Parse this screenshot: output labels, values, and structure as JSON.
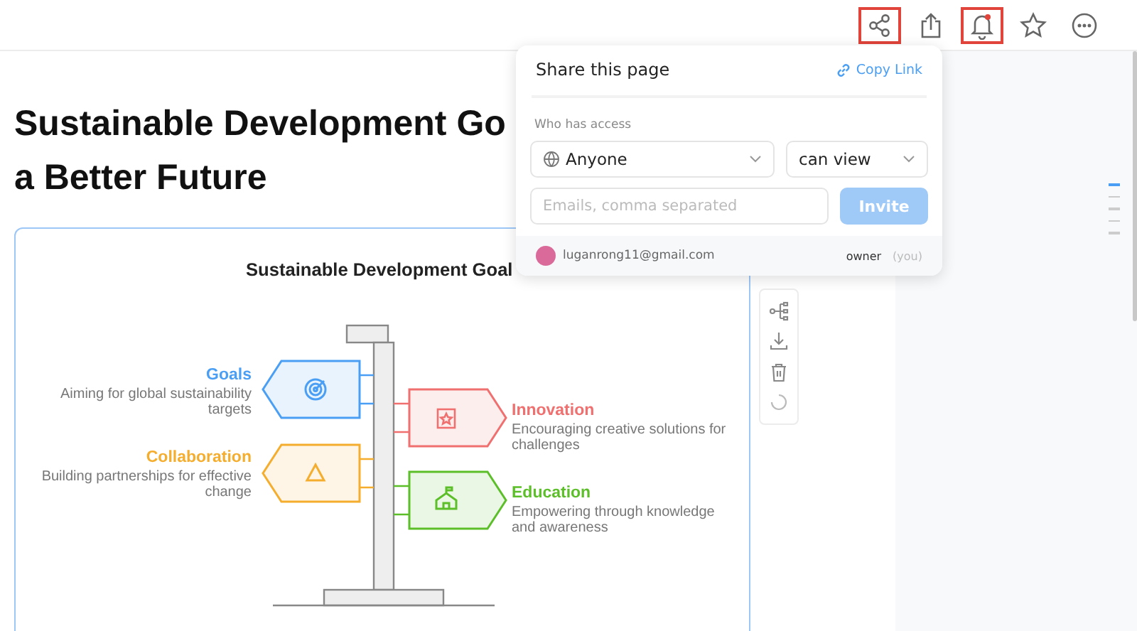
{
  "toolbar": [
    {
      "kind": "share",
      "highlighted": true,
      "dot": false
    },
    {
      "kind": "export",
      "highlighted": false,
      "dot": false
    },
    {
      "kind": "bell",
      "highlighted": true,
      "dot": true
    },
    {
      "kind": "star",
      "highlighted": false,
      "dot": false
    },
    {
      "kind": "more",
      "highlighted": false,
      "dot": false
    }
  ],
  "heading_lines": [
    "Sustainable Development Go",
    "a Better Future"
  ],
  "card": {
    "title": "Sustainable Development Goal",
    "items": [
      {
        "kind": "target",
        "label": "Goals",
        "description": "Aiming for global sustainability targets",
        "color": "#4a9ff5"
      },
      {
        "kind": "badge",
        "label": "Innovation",
        "description": "Encouraging creative solutions for challenges",
        "color": "#f07070"
      },
      {
        "kind": "triangle",
        "label": "Collaboration",
        "description": "Building partnerships for effective change",
        "color": "#f5ad2e"
      },
      {
        "kind": "school",
        "label": "Education",
        "description": "Empowering through knowledge and awareness",
        "color": "#5cbf2a"
      }
    ]
  },
  "side_tools": [
    {
      "kind": "hierarchy"
    },
    {
      "kind": "download"
    },
    {
      "kind": "trash"
    },
    {
      "kind": "spinner"
    }
  ],
  "outline": [
    {
      "selected": true
    },
    {
      "selected": false
    },
    {
      "selected": false
    },
    {
      "selected": false
    },
    {
      "selected": false
    }
  ],
  "share": {
    "title": "Share this page",
    "copy_link": "Copy Link",
    "access_label": "Who has access",
    "access": "Anyone",
    "permission": "can view",
    "email_placeholder": "Emails, comma separated",
    "invite": "Invite",
    "invite_disabled": true,
    "user_email": "luganrong11@gmail.com",
    "role": "owner",
    "role_note": "(you)"
  }
}
